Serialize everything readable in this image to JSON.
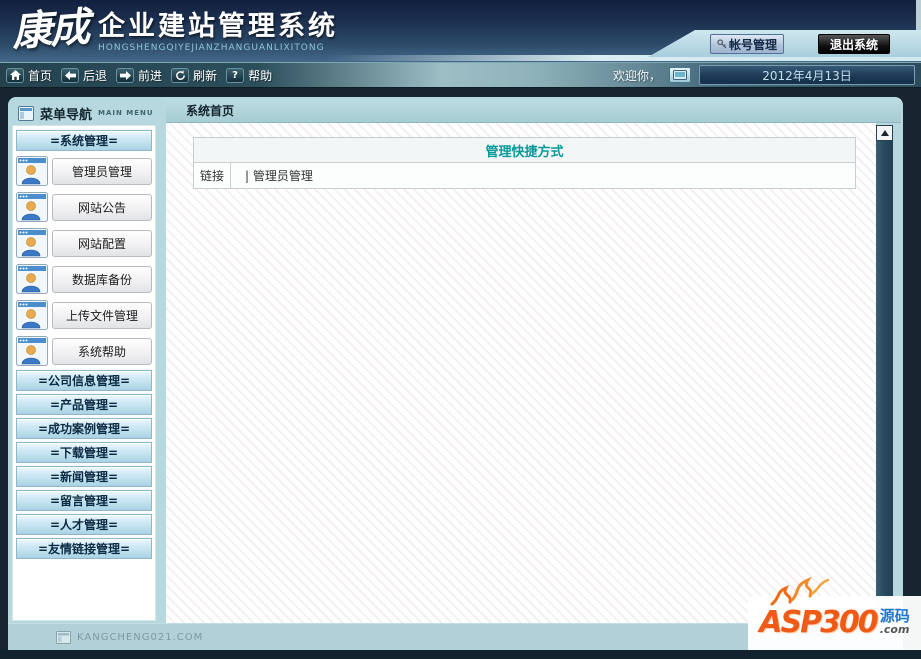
{
  "header": {
    "logo_main": "康成",
    "logo_title": "企业建站管理系统",
    "logo_subtitle": "HONGSHENGQIYEJIANZHANGUANLIXITONG",
    "account_button": "帐号管理",
    "logout_button": "退出系统"
  },
  "navbar": {
    "items": [
      {
        "label": "首页",
        "icon": "home-icon"
      },
      {
        "label": "后退",
        "icon": "arrow-left-icon"
      },
      {
        "label": "前进",
        "icon": "arrow-right-icon"
      },
      {
        "label": "刷新",
        "icon": "refresh-icon"
      },
      {
        "label": "帮助",
        "icon": "help-icon"
      }
    ],
    "welcome": "欢迎你，",
    "date": "2012年4月13日"
  },
  "sidebar": {
    "title": "菜单导航",
    "subtitle": "MAIN MENU",
    "active_section": "=系统管理=",
    "menu_items": [
      "管理员管理",
      "网站公告",
      "网站配置",
      "数据库备份",
      "上传文件管理",
      "系统帮助"
    ],
    "sections": [
      "=公司信息管理=",
      "=产品管理=",
      "=成功案例管理=",
      "=下载管理=",
      "=新闻管理=",
      "=留言管理=",
      "=人才管理=",
      "=友情链接管理="
    ]
  },
  "content": {
    "tab_title": "系统首页",
    "table": {
      "title": "管理快捷方式",
      "row_label": "链接",
      "row_value": "| 管理员管理"
    }
  },
  "footer": {
    "site": "KANGCHENG021.COM"
  },
  "watermark": {
    "brand": "ASP300",
    "suffix": "源码",
    "domain": ".com"
  },
  "colors": {
    "header_top": "#131f3e",
    "header_bottom": "#44688a",
    "panel_bg": "#b6d8de",
    "table_title_teal": "#089a9a",
    "watermark_orange": "#ef5a17",
    "watermark_blue": "#2277cc",
    "scrollbar_track": "#2a4b61"
  }
}
